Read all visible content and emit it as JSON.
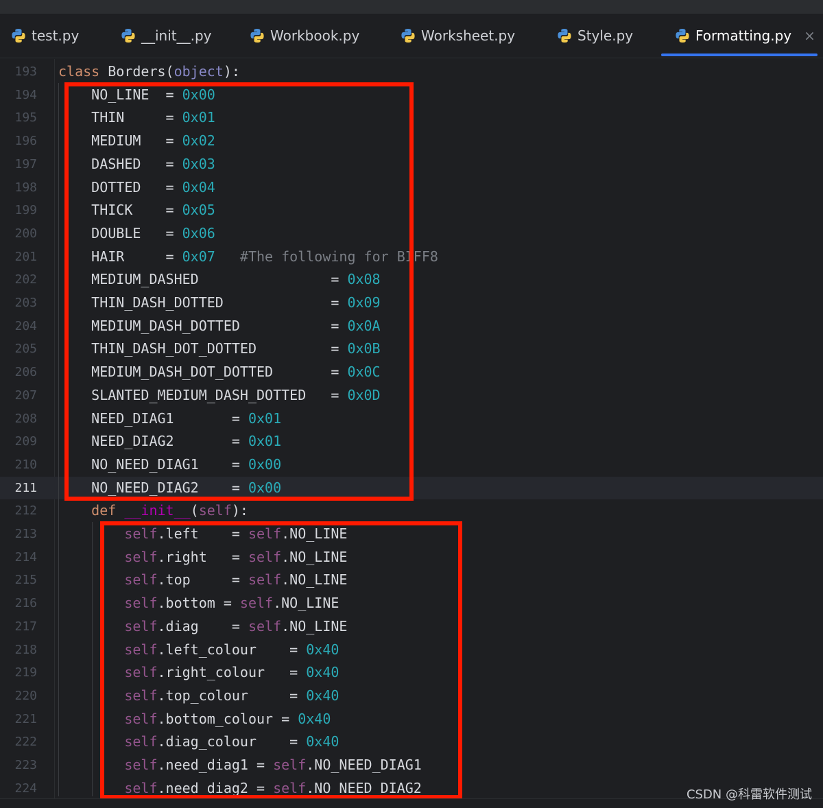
{
  "tabs": [
    {
      "label": "test.py",
      "icon": "python-file-icon"
    },
    {
      "label": "__init__.py",
      "icon": "python-file-icon"
    },
    {
      "label": "Workbook.py",
      "icon": "python-file-icon"
    },
    {
      "label": "Worksheet.py",
      "icon": "python-file-icon"
    },
    {
      "label": "Style.py",
      "icon": "python-file-icon"
    },
    {
      "label": "Formatting.py",
      "icon": "python-file-icon",
      "active": true,
      "close": "×"
    }
  ],
  "editor": {
    "current_line": "211",
    "lines": [
      {
        "n": "193",
        "t": [
          [
            "kw",
            "class "
          ],
          [
            "plain",
            "Borders("
          ],
          [
            "builtin",
            "object"
          ],
          [
            "plain",
            "):"
          ]
        ]
      },
      {
        "n": "194",
        "t": [
          [
            "plain",
            "    NO_LINE  = "
          ],
          [
            "num",
            "0x00"
          ]
        ]
      },
      {
        "n": "195",
        "t": [
          [
            "plain",
            "    THIN     = "
          ],
          [
            "num",
            "0x01"
          ]
        ]
      },
      {
        "n": "196",
        "t": [
          [
            "plain",
            "    MEDIUM   = "
          ],
          [
            "num",
            "0x02"
          ]
        ]
      },
      {
        "n": "197",
        "t": [
          [
            "plain",
            "    DASHED   = "
          ],
          [
            "num",
            "0x03"
          ]
        ]
      },
      {
        "n": "198",
        "t": [
          [
            "plain",
            "    DOTTED   = "
          ],
          [
            "num",
            "0x04"
          ]
        ]
      },
      {
        "n": "199",
        "t": [
          [
            "plain",
            "    THICK    = "
          ],
          [
            "num",
            "0x05"
          ]
        ]
      },
      {
        "n": "200",
        "t": [
          [
            "plain",
            "    DOUBLE   = "
          ],
          [
            "num",
            "0x06"
          ]
        ]
      },
      {
        "n": "201",
        "t": [
          [
            "plain",
            "    HAIR     = "
          ],
          [
            "num",
            "0x07"
          ],
          [
            "plain",
            "   "
          ],
          [
            "comment",
            "#The following for BIFF8"
          ]
        ]
      },
      {
        "n": "202",
        "t": [
          [
            "plain",
            "    MEDIUM_DASHED                = "
          ],
          [
            "num",
            "0x08"
          ]
        ]
      },
      {
        "n": "203",
        "t": [
          [
            "plain",
            "    THIN_DASH_DOTTED             = "
          ],
          [
            "num",
            "0x09"
          ]
        ]
      },
      {
        "n": "204",
        "t": [
          [
            "plain",
            "    MEDIUM_DASH_DOTTED           = "
          ],
          [
            "num",
            "0x0A"
          ]
        ]
      },
      {
        "n": "205",
        "t": [
          [
            "plain",
            "    THIN_DASH_DOT_DOTTED         = "
          ],
          [
            "num",
            "0x0B"
          ]
        ]
      },
      {
        "n": "206",
        "t": [
          [
            "plain",
            "    MEDIUM_DASH_DOT_DOTTED       = "
          ],
          [
            "num",
            "0x0C"
          ]
        ]
      },
      {
        "n": "207",
        "t": [
          [
            "plain",
            "    SLANTED_MEDIUM_DASH_DOTTED   = "
          ],
          [
            "num",
            "0x0D"
          ]
        ]
      },
      {
        "n": "208",
        "t": [
          [
            "plain",
            "    NEED_DIAG1       = "
          ],
          [
            "num",
            "0x01"
          ]
        ]
      },
      {
        "n": "209",
        "t": [
          [
            "plain",
            "    NEED_DIAG2       = "
          ],
          [
            "num",
            "0x01"
          ]
        ]
      },
      {
        "n": "210",
        "t": [
          [
            "plain",
            "    NO_NEED_DIAG1    = "
          ],
          [
            "num",
            "0x00"
          ]
        ]
      },
      {
        "n": "211",
        "t": [
          [
            "plain",
            "    NO_NEED_DIAG2    = "
          ],
          [
            "num",
            "0x00"
          ]
        ]
      },
      {
        "n": "212",
        "t": [
          [
            "plain",
            "    "
          ],
          [
            "kw",
            "def "
          ],
          [
            "dunder",
            "__init__"
          ],
          [
            "plain",
            "("
          ],
          [
            "self",
            "self"
          ],
          [
            "plain",
            "):"
          ]
        ]
      },
      {
        "n": "213",
        "t": [
          [
            "plain",
            "        "
          ],
          [
            "self",
            "self"
          ],
          [
            "plain",
            ".left    = "
          ],
          [
            "self",
            "self"
          ],
          [
            "plain",
            ".NO_LINE"
          ]
        ]
      },
      {
        "n": "214",
        "t": [
          [
            "plain",
            "        "
          ],
          [
            "self",
            "self"
          ],
          [
            "plain",
            ".right   = "
          ],
          [
            "self",
            "self"
          ],
          [
            "plain",
            ".NO_LINE"
          ]
        ]
      },
      {
        "n": "215",
        "t": [
          [
            "plain",
            "        "
          ],
          [
            "self",
            "self"
          ],
          [
            "plain",
            ".top     = "
          ],
          [
            "self",
            "self"
          ],
          [
            "plain",
            ".NO_LINE"
          ]
        ]
      },
      {
        "n": "216",
        "t": [
          [
            "plain",
            "        "
          ],
          [
            "self",
            "self"
          ],
          [
            "plain",
            ".bottom = "
          ],
          [
            "self",
            "self"
          ],
          [
            "plain",
            ".NO_LINE"
          ]
        ]
      },
      {
        "n": "217",
        "t": [
          [
            "plain",
            "        "
          ],
          [
            "self",
            "self"
          ],
          [
            "plain",
            ".diag    = "
          ],
          [
            "self",
            "self"
          ],
          [
            "plain",
            ".NO_LINE"
          ]
        ]
      },
      {
        "n": "218",
        "t": [
          [
            "plain",
            "        "
          ],
          [
            "self",
            "self"
          ],
          [
            "plain",
            ".left_colour    = "
          ],
          [
            "num",
            "0x40"
          ]
        ]
      },
      {
        "n": "219",
        "t": [
          [
            "plain",
            "        "
          ],
          [
            "self",
            "self"
          ],
          [
            "plain",
            ".right_colour   = "
          ],
          [
            "num",
            "0x40"
          ]
        ]
      },
      {
        "n": "220",
        "t": [
          [
            "plain",
            "        "
          ],
          [
            "self",
            "self"
          ],
          [
            "plain",
            ".top_colour     = "
          ],
          [
            "num",
            "0x40"
          ]
        ]
      },
      {
        "n": "221",
        "t": [
          [
            "plain",
            "        "
          ],
          [
            "self",
            "self"
          ],
          [
            "plain",
            ".bottom_colour = "
          ],
          [
            "num",
            "0x40"
          ]
        ]
      },
      {
        "n": "222",
        "t": [
          [
            "plain",
            "        "
          ],
          [
            "self",
            "self"
          ],
          [
            "plain",
            ".diag_colour    = "
          ],
          [
            "num",
            "0x40"
          ]
        ]
      },
      {
        "n": "223",
        "t": [
          [
            "plain",
            "        "
          ],
          [
            "self",
            "self"
          ],
          [
            "plain",
            ".need_diag1 = "
          ],
          [
            "self",
            "self"
          ],
          [
            "plain",
            ".NO_NEED_DIAG1"
          ]
        ]
      },
      {
        "n": "224",
        "t": [
          [
            "plain",
            "        "
          ],
          [
            "self",
            "self"
          ],
          [
            "plain",
            ".need_diag2 = "
          ],
          [
            "self",
            "self"
          ],
          [
            "plain",
            ".NO_NEED_DIAG2"
          ]
        ]
      }
    ]
  },
  "colors": {
    "background": "#1e1f22",
    "keyword": "#cf8e6d",
    "number": "#2aacb8",
    "self": "#94558d",
    "comment": "#7a7e85",
    "highlight_box": "#ff1a00",
    "active_tab_underline": "#3574f0"
  },
  "watermark": "CSDN @科雷软件测试"
}
